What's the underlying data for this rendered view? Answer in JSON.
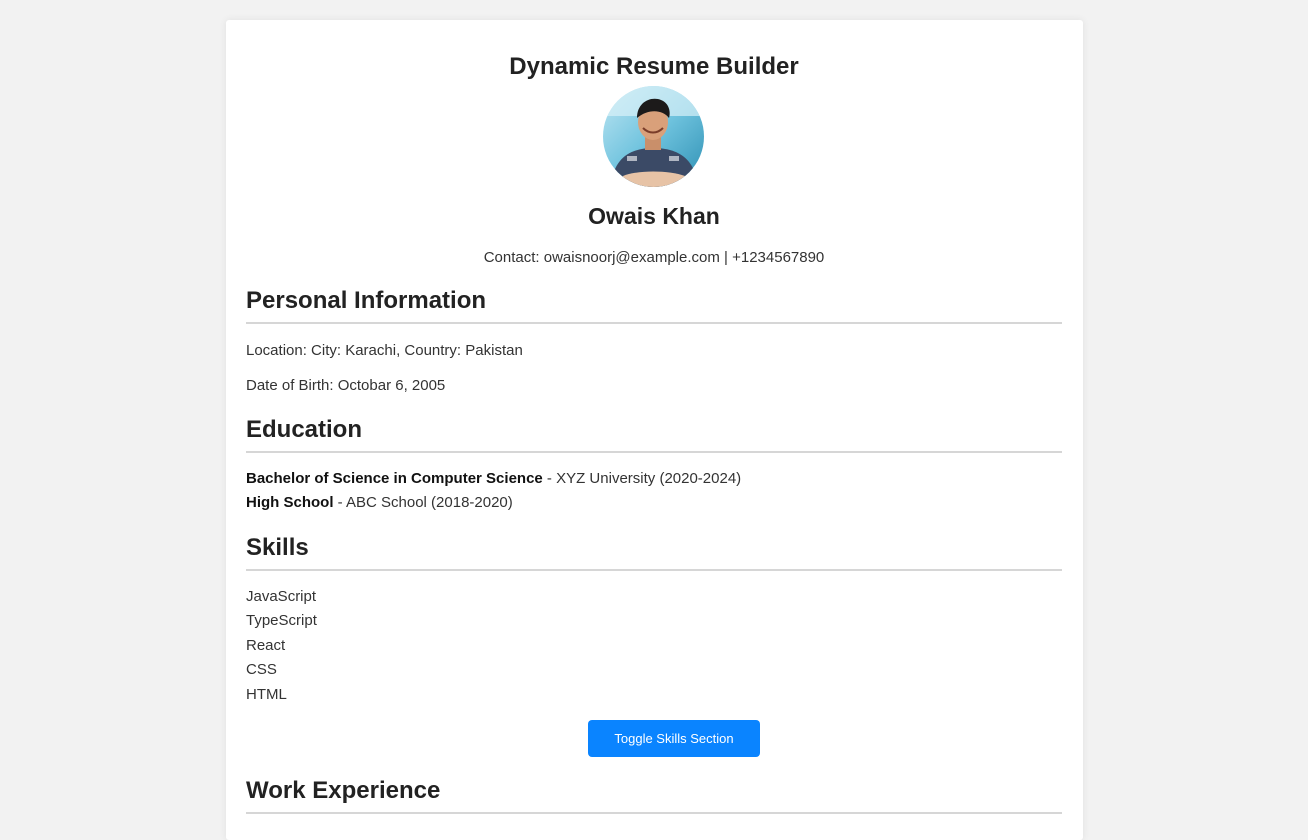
{
  "header": {
    "title": "Dynamic Resume Builder",
    "name": "Owais Khan",
    "contact": "Contact: owaisnoorj@example.com | +1234567890"
  },
  "personal": {
    "heading": "Personal Information",
    "location": "Location: City: Karachi, Country: Pakistan",
    "dob": "Date of Birth: Octobar 6, 2005"
  },
  "education": {
    "heading": "Education",
    "items": [
      {
        "degree": "Bachelor of Science in Computer Science",
        "detail": " - XYZ University (2020-2024)"
      },
      {
        "degree": "High School",
        "detail": " - ABC School (2018-2020)"
      }
    ]
  },
  "skills": {
    "heading": "Skills",
    "items": [
      "JavaScript",
      "TypeScript",
      "React",
      "CSS",
      "HTML"
    ],
    "toggle_label": "Toggle Skills Section"
  },
  "work": {
    "heading": "Work Experience"
  },
  "colors": {
    "accent": "#0a84ff",
    "background": "#f2f2f2",
    "card": "#ffffff",
    "rule": "#d6d6d6"
  }
}
